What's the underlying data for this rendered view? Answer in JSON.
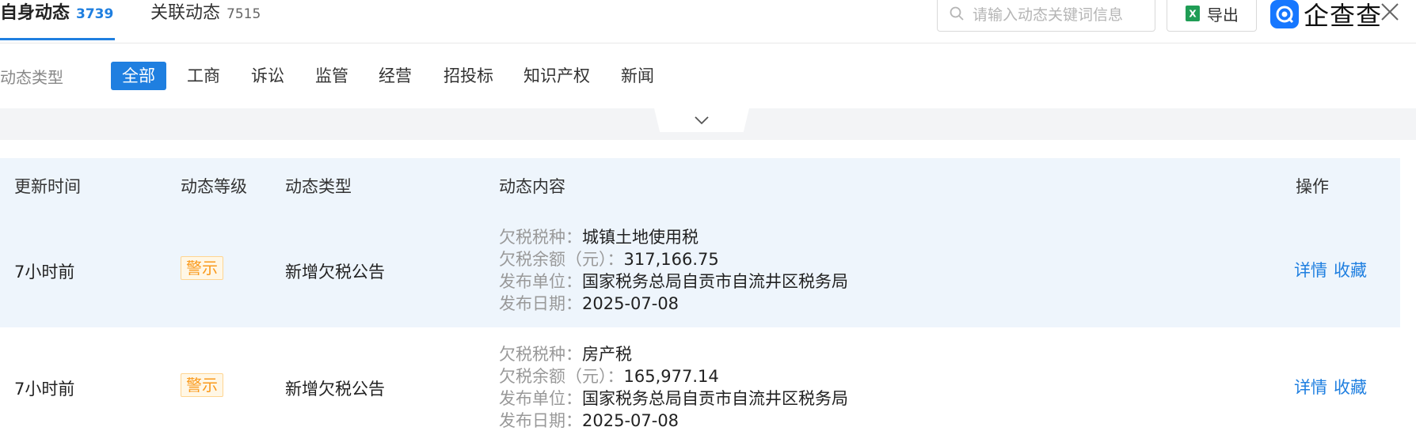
{
  "tabs": {
    "self": {
      "label": "自身动态",
      "count": "3739"
    },
    "related": {
      "label": "关联动态",
      "count": "7515"
    }
  },
  "search": {
    "placeholder": "请输入动态关键词信息"
  },
  "export": {
    "label": "导出"
  },
  "logo": {
    "text": "企查查"
  },
  "filter": {
    "label": "动态类型",
    "items": [
      "全部",
      "工商",
      "诉讼",
      "监管",
      "经营",
      "招投标",
      "知识产权",
      "新闻"
    ],
    "active": "全部"
  },
  "table": {
    "headers": [
      "更新时间",
      "动态等级",
      "动态类型",
      "动态内容",
      "操作"
    ],
    "rows": [
      {
        "time": "7小时前",
        "level": "警示",
        "type": "新增欠税公告",
        "details": [
          {
            "k": "欠税税种：",
            "v": "城镇土地使用税"
          },
          {
            "k": "欠税余额（元）：",
            "v": "317,166.75"
          },
          {
            "k": "发布单位：",
            "v": "国家税务总局自贡市自流井区税务局"
          },
          {
            "k": "发布日期：",
            "v": "2025-07-08"
          }
        ],
        "actions": [
          "详情",
          "收藏"
        ]
      },
      {
        "time": "7小时前",
        "level": "警示",
        "type": "新增欠税公告",
        "details": [
          {
            "k": "欠税税种：",
            "v": "房产税"
          },
          {
            "k": "欠税余额（元）：",
            "v": "165,977.14"
          },
          {
            "k": "发布单位：",
            "v": "国家税务总局自贡市自流井区税务局"
          },
          {
            "k": "发布日期：",
            "v": "2025-07-08"
          }
        ],
        "actions": [
          "详情",
          "收藏"
        ]
      }
    ]
  },
  "colors": {
    "accent": "#1f7fe0",
    "warning": "#fa9a1c",
    "row_highlight": "#eef5fc"
  }
}
